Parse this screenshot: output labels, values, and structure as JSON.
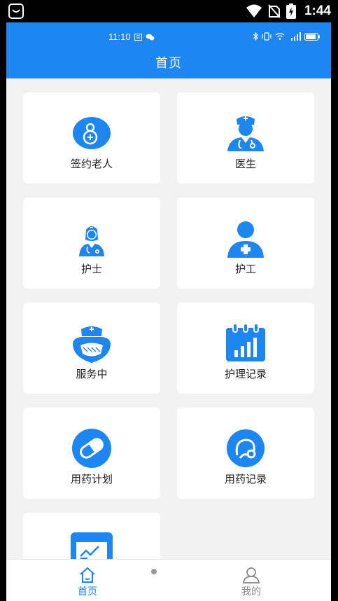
{
  "device_status": {
    "time": "1:44"
  },
  "app_status": {
    "time": "11:10"
  },
  "header": {
    "title": "首页"
  },
  "menu": [
    {
      "label": "签约老人",
      "icon": "elderly-person-icon"
    },
    {
      "label": "医生",
      "icon": "doctor-icon"
    },
    {
      "label": "护士",
      "icon": "nurse-icon"
    },
    {
      "label": "护工",
      "icon": "caregiver-icon"
    },
    {
      "label": "服务中",
      "icon": "in-service-icon"
    },
    {
      "label": "护理记录",
      "icon": "care-record-icon"
    },
    {
      "label": "用药计划",
      "icon": "medication-plan-icon"
    },
    {
      "label": "用药记录",
      "icon": "medication-record-icon"
    },
    {
      "label": "",
      "icon": "chart-card-icon"
    }
  ],
  "bottom_nav": {
    "home_label": "首页",
    "mine_label": "我的"
  },
  "colors": {
    "primary": "#1d86f0",
    "background": "#f2f2f2",
    "inactive": "#888888"
  }
}
